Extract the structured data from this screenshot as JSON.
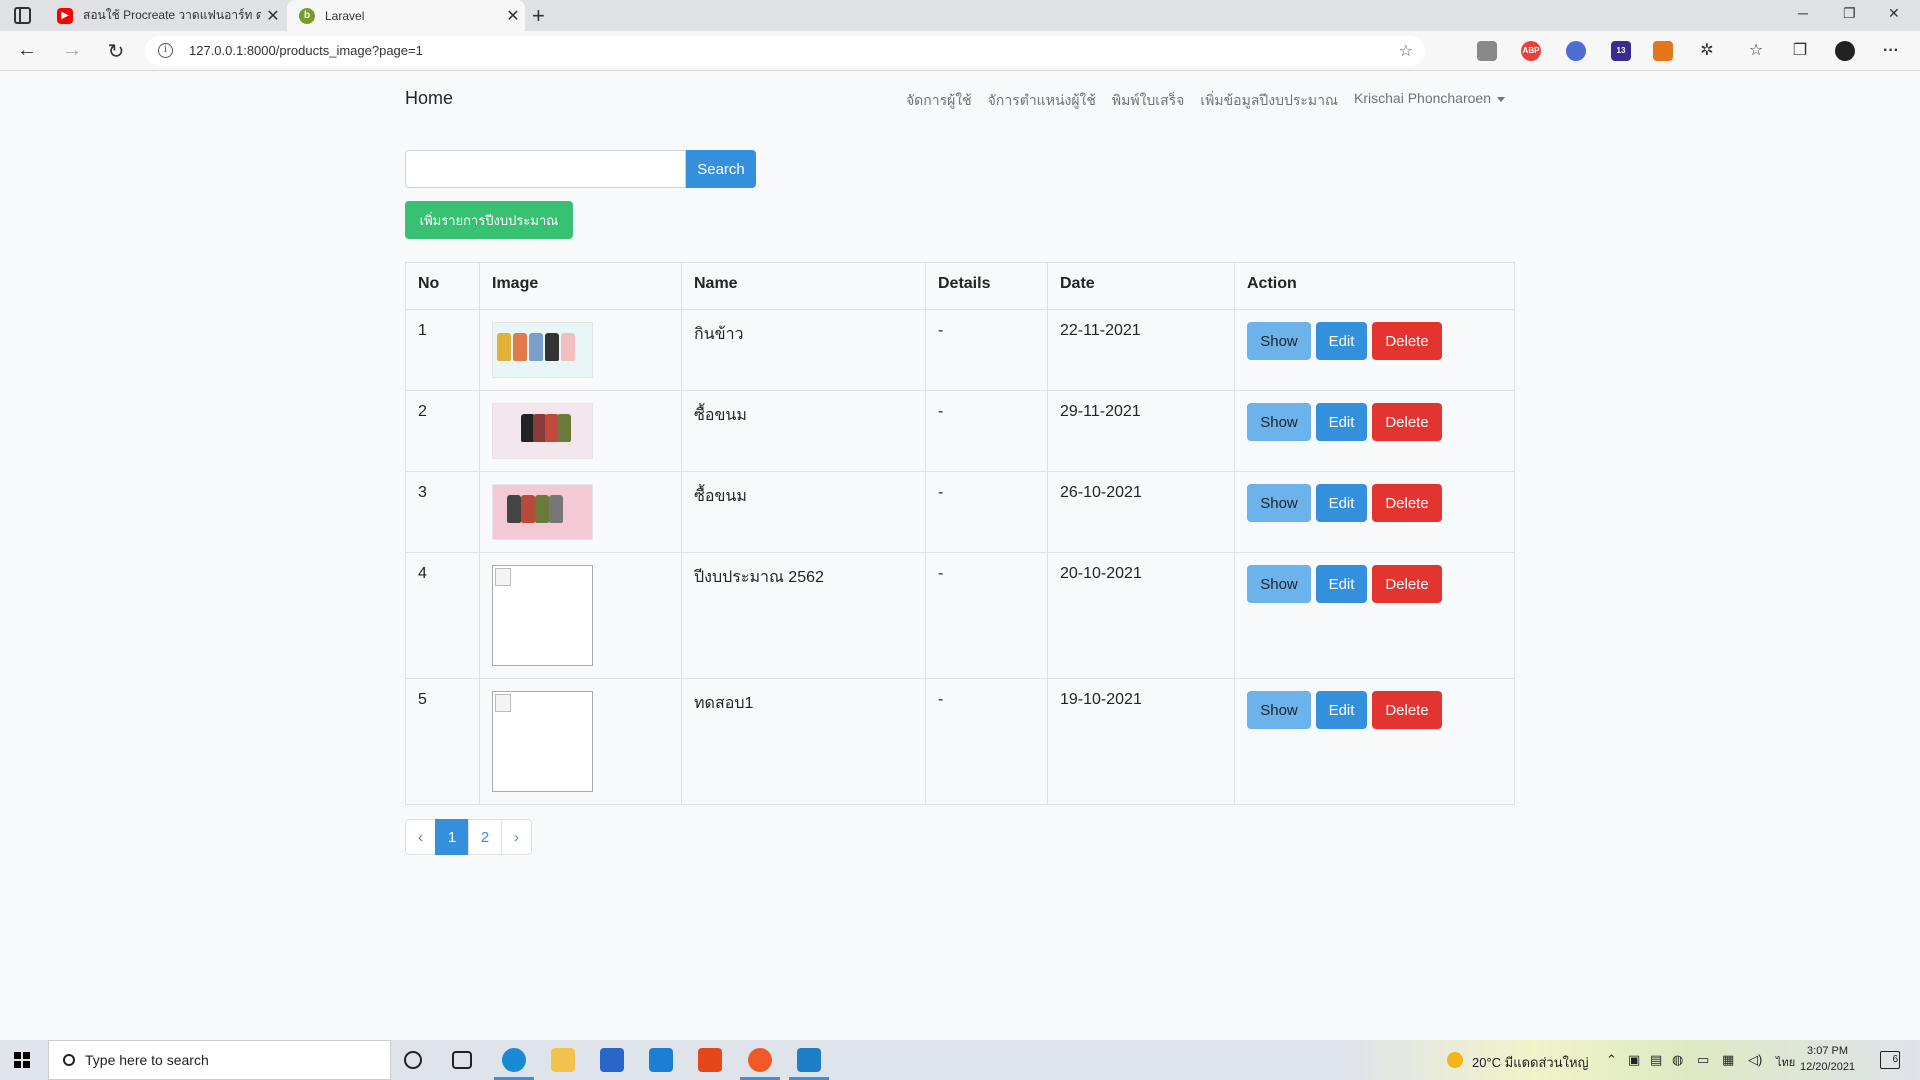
{
  "browser": {
    "tabs": [
      {
        "title": "สอนใช้ Procreate วาดแฟนอาร์ท ดาร..."
      },
      {
        "title": "Laravel"
      }
    ],
    "url": "127.0.0.1:8000/products_image?page=1"
  },
  "nav": {
    "brand": "Home",
    "links": [
      "จัดการผู้ใช้",
      "จัการตำแหน่งผู้ใช้",
      "พิมพ์ใบเสร็จ",
      "เพิ่มข้อมูลปีงบประมาณ"
    ],
    "user": "Krischai Phoncharoen"
  },
  "search": {
    "value": "",
    "button_label": "Search"
  },
  "add_button": "เพิ่มรายการปีงบประมาณ",
  "table": {
    "headers": [
      "No",
      "Image",
      "Name",
      "Details",
      "Date",
      "Action"
    ],
    "rows": [
      {
        "no": "1",
        "name": "กินข้าว",
        "details": "-",
        "date": "22-11-2021",
        "image": "loaded"
      },
      {
        "no": "2",
        "name": "ซื้อขนม",
        "details": "-",
        "date": "29-11-2021",
        "image": "loaded"
      },
      {
        "no": "3",
        "name": "ซื้อขนม",
        "details": "-",
        "date": "26-10-2021",
        "image": "loaded"
      },
      {
        "no": "4",
        "name": "ปีงบประมาณ 2562",
        "details": "-",
        "date": "20-10-2021",
        "image": "broken"
      },
      {
        "no": "5",
        "name": "ทดสอบ1",
        "details": "-",
        "date": "19-10-2021",
        "image": "broken"
      }
    ],
    "actions": {
      "show": "Show",
      "edit": "Edit",
      "delete": "Delete"
    }
  },
  "pagination": {
    "prev": "‹",
    "pages": [
      "1",
      "2"
    ],
    "current": "1",
    "next": "›"
  },
  "taskbar": {
    "search_placeholder": "Type here to search",
    "weather": "20°C  มีแดดส่วนใหญ่",
    "lang": "ไทย",
    "time": "3:07 PM",
    "date": "12/20/2021",
    "notifications": "6"
  },
  "colors": {
    "primary": "#3490dc",
    "info": "#6cb2eb",
    "success": "#38c172",
    "danger": "#e3342f"
  }
}
